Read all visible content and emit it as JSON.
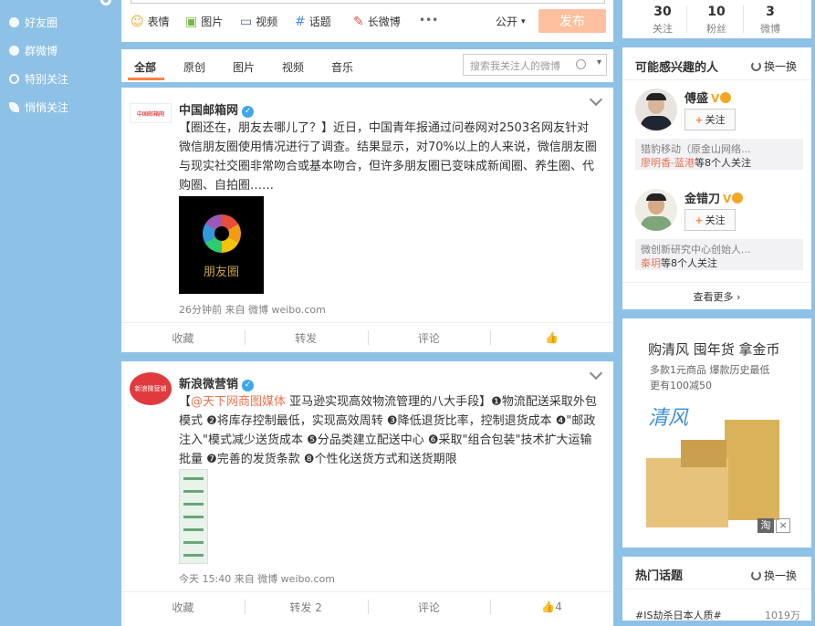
{
  "left_nav": {
    "items": [
      {
        "label": "好友圈"
      },
      {
        "label": "群微博"
      },
      {
        "label": "特别关注"
      },
      {
        "label": "悄悄关注"
      }
    ]
  },
  "publisher": {
    "tools": {
      "emoji": "表情",
      "image": "图片",
      "video": "视频",
      "topic": "话题",
      "long_weibo": "长微博",
      "more": "•••"
    },
    "visibility": "公开",
    "publish": "发布"
  },
  "feed_tabs": {
    "all": "全部",
    "original": "原创",
    "image": "图片",
    "video": "视频",
    "music": "音乐",
    "search_placeholder": "搜索我关注人的微博"
  },
  "posts": [
    {
      "author": "中国邮箱网",
      "avatar_text": "中国邮箱网",
      "text": "【圈还在，朋友去哪儿了？】近日，中国青年报通过问卷网对2503名网友针对微信朋友圈使用情况进行了调查。结果显示，对70%以上的人来说，微信朋友圈与现实社交圈非常吻合或基本吻合，但许多朋友圈已变味成新闻圈、养生圈、代购圈、自拍圈……",
      "image_caption": "朋友圈",
      "meta": "26分钟前 来自 微博 weibo.com",
      "actions": {
        "fav": "收藏",
        "forward": "转发",
        "comment": "评论",
        "like": ""
      }
    },
    {
      "author": "新浪微营销",
      "avatar_text": "新浪微营销",
      "mention": "@天下网商图媒体",
      "text": " 亚马逊实现高效物流管理的八大手段】❶物流配送采取外包模式 ❷将库存控制最低，实现高效周转 ❸降低退货比率，控制退货成本 ❹\"邮政注入\"模式减少送货成本 ❺分品类建立配送中心 ❻采取\"组合包装\"技术扩大运输批量 ❼完善的发货条款 ❽个性化送货方式和送货期限",
      "text_prefix": "【",
      "meta": "今天 15:40 来自 微博 weibo.com",
      "actions": {
        "fav": "收藏",
        "forward": "转发 2",
        "comment": "评论",
        "like": "4"
      }
    }
  ],
  "profile_stats": [
    {
      "value": "30",
      "label": "关注"
    },
    {
      "value": "10",
      "label": "粉丝"
    },
    {
      "value": "3",
      "label": "微博"
    }
  ],
  "recommend": {
    "title": "可能感兴趣的人",
    "change": "换一换",
    "users": [
      {
        "name": "傅盛",
        "follow": "关注",
        "desc": "猎豹移动（原金山网络...",
        "mutual_names": "廖明香-蓝港",
        "mutual_suffix": "等8个人关注"
      },
      {
        "name": "金错刀",
        "follow": "关注",
        "desc": "微创新研究中心创始人...",
        "mutual_names": "秦玥",
        "mutual_suffix": "等8个人关注"
      }
    ],
    "more": "查看更多"
  },
  "ad": {
    "headline": "购清风 囤年货 拿金币",
    "sub1": "多款1元商品 爆款历史最低",
    "sub2": "更有100减50",
    "brand": "清风",
    "corner": "淘"
  },
  "hot_topics": {
    "title": "热门话题",
    "change": "换一换",
    "items": [
      {
        "name": "#IS劫杀日本人质#",
        "count": "1019万"
      }
    ]
  },
  "colors": {
    "background": "#8ec1e6",
    "accent_orange": "#ff8140",
    "link": "#eb7350",
    "verified_blue": "#3ea7e8",
    "publish_disabled": "#ffc09f"
  }
}
